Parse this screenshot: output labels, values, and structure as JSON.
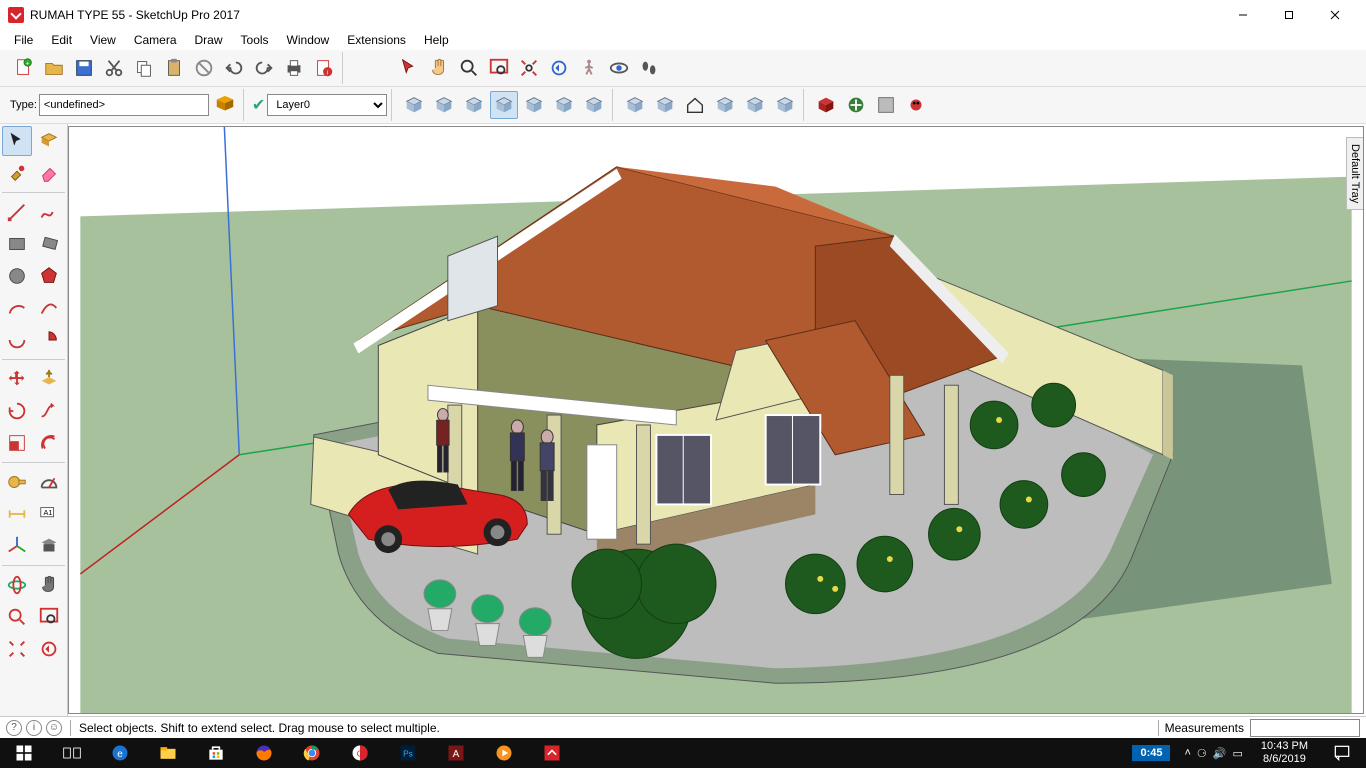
{
  "titlebar": {
    "text": "RUMAH TYPE 55 - SketchUp Pro 2017"
  },
  "menu": {
    "items": [
      "File",
      "Edit",
      "View",
      "Camera",
      "Draw",
      "Tools",
      "Window",
      "Extensions",
      "Help"
    ]
  },
  "toolbar1": {
    "icons": [
      "new-file",
      "open-file",
      "save-file",
      "cut",
      "copy",
      "paste",
      "delete",
      "undo",
      "redo",
      "print",
      "model-info"
    ]
  },
  "toolbar1b": {
    "icons": [
      "select-arrow",
      "hand",
      "zoom",
      "zoom-window",
      "zoom-extents",
      "prev-view",
      "walk",
      "look-around",
      "footprints"
    ]
  },
  "toolbar2": {
    "type_label": "Type:",
    "type_value": "<undefined>",
    "layer_value": "Layer0",
    "styles": [
      "style-wire",
      "style-hidden",
      "style-shaded",
      "style-shadedtex",
      "style-mono",
      "style-xray",
      "style-backedges"
    ],
    "components": [
      "comp-house",
      "comp-box",
      "comp-home",
      "comp-building",
      "comp-shed",
      "comp-group"
    ],
    "warehouse": [
      "wh-get",
      "wh-share",
      "wh-ext",
      "wh-bug"
    ]
  },
  "lefttools": [
    [
      "select-tool",
      "lasso-tool"
    ],
    [
      "paint-tool",
      "eraser-tool"
    ],
    "sep",
    [
      "line-tool",
      "freehand-tool"
    ],
    [
      "rect-tool",
      "rotrect-tool"
    ],
    [
      "circle-tool",
      "polygon-tool"
    ],
    [
      "arc-tool",
      "arc2-tool"
    ],
    [
      "arc3-tool",
      "pie-tool"
    ],
    "sep",
    [
      "move-tool",
      "pushpull-tool"
    ],
    [
      "rotate-tool",
      "followme-tool"
    ],
    [
      "scale-tool",
      "offset-tool"
    ],
    "sep",
    [
      "tape-tool",
      "protractor-tool"
    ],
    [
      "dim-tool",
      "text-tool"
    ],
    [
      "axes-tool",
      "section-tool"
    ],
    "sep",
    [
      "orbit-tool",
      "pan-tool"
    ],
    [
      "zoom-tool",
      "zoomwin-tool"
    ],
    [
      "zoomext-tool",
      "prev-tool"
    ]
  ],
  "tray": {
    "label": "Default Tray"
  },
  "status": {
    "hint": "Select objects. Shift to extend select. Drag mouse to select multiple.",
    "measurements_label": "Measurements"
  },
  "taskbar": {
    "apps": [
      "start",
      "taskview",
      "edge",
      "explorer",
      "store",
      "firefox",
      "chrome",
      "qbit",
      "photoshop",
      "autocad",
      "wmp",
      "sketchup"
    ],
    "rec_time": "0:45",
    "time": "10:43 PM",
    "date": "8/6/2019"
  },
  "colors": {
    "ground": "#a7c19c",
    "roof": "#b25a2f",
    "wall_light": "#e9e7b4",
    "wall_dark": "#8a8f5e",
    "shadow": "#6f8c74",
    "car": "#d51e1e"
  }
}
